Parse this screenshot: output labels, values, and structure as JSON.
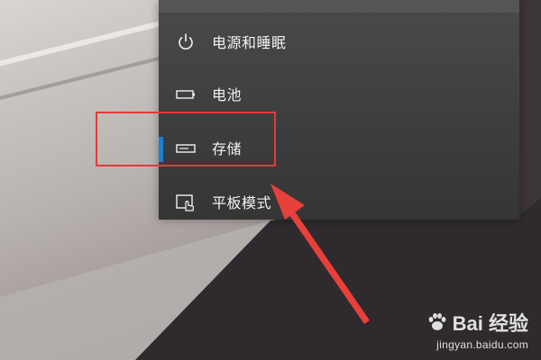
{
  "sidebar": {
    "items": [
      {
        "label": "电源和睡眠",
        "icon": "power-icon",
        "selected": false
      },
      {
        "label": "电池",
        "icon": "battery-icon",
        "selected": false
      },
      {
        "label": "存储",
        "icon": "storage-icon",
        "selected": true
      },
      {
        "label": "平板模式",
        "icon": "tablet-mode-icon",
        "selected": false
      }
    ]
  },
  "colors": {
    "accent": "#1a7fd6",
    "annotation": "#e23a3a",
    "panel_bg": "#3f3f3f"
  },
  "watermark": {
    "brand": "Bai 经验",
    "url": "jingyan.baidu.com"
  }
}
